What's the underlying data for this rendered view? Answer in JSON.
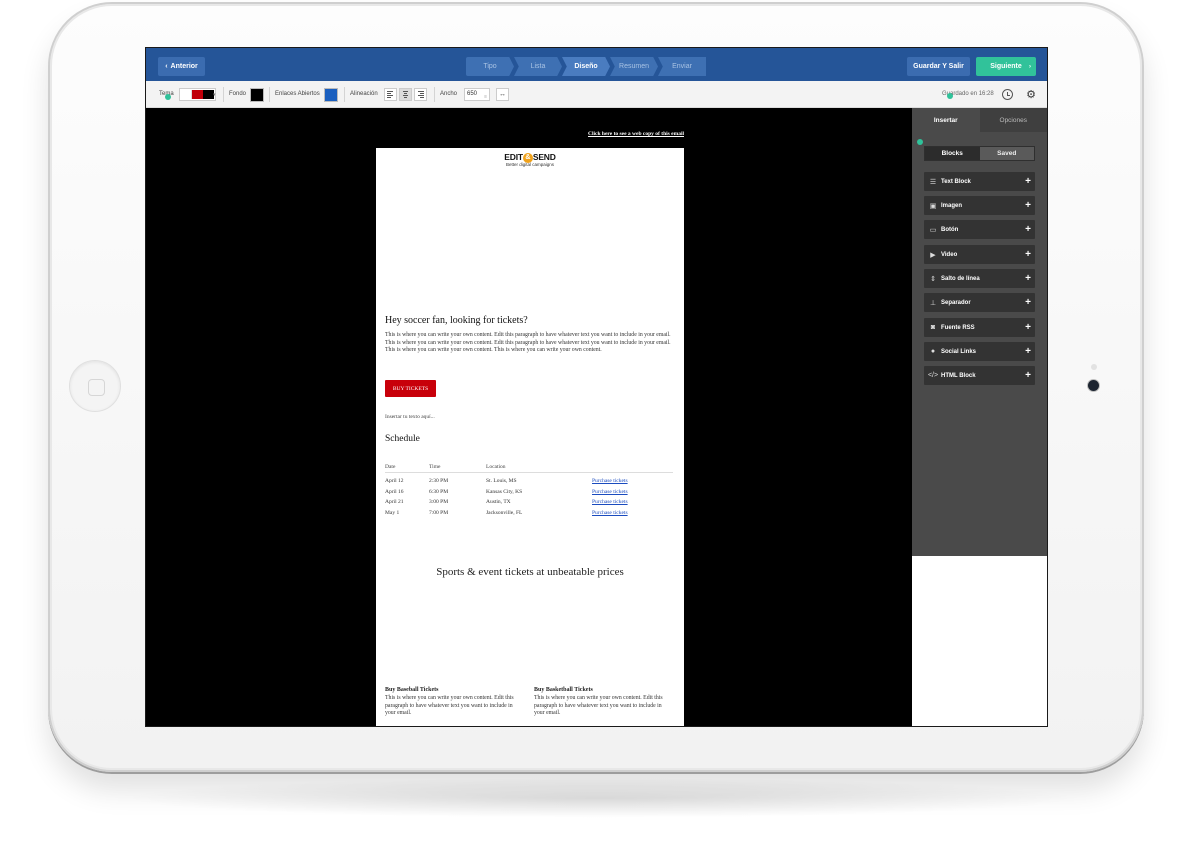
{
  "nav": {
    "prev_label": "Anterior",
    "steps": [
      "Tipo",
      "Lista",
      "Diseño",
      "Resumen",
      "Enviar"
    ],
    "active_step": "Diseño",
    "save_exit_label": "Guardar Y Salir",
    "next_label": "Siguiente"
  },
  "toolbar": {
    "theme_label": "Tema",
    "background_label": "Fondo",
    "links_label": "Enlaces Abiertos",
    "align_label": "Alineación",
    "width_label": "Ancho",
    "width_value": "650",
    "saved_text": "Guardado en 16:28",
    "colors": {
      "theme_a": "#c0000a",
      "theme_b": "#000000",
      "background": "#000000",
      "links": "#1a5fbf"
    }
  },
  "email": {
    "web_copy_link": "Click here to see a web copy of this email",
    "logo_left": "EDIT",
    "logo_amp": "&",
    "logo_right": "SEND",
    "logo_tagline": "Better digital campaigns",
    "heading": "Hey soccer fan, looking for tickets?",
    "paragraph": "This is where you can write your own content. Edit this paragraph to have whatever text you want to include in your email. This is where you can write your own content. Edit this paragraph to have whatever text you want to include in your email. This is where you can write your own content. This is where you can write your own content.",
    "buy_button": "BUY TICKETS",
    "insert_text": "Insertar tu texto aquí...",
    "schedule_title": "Schedule",
    "table": {
      "headers": [
        "Date",
        "Time",
        "Location",
        ""
      ],
      "rows": [
        [
          "April 12",
          "2:30 PM",
          "St. Louis, MS",
          "Purchase tickets"
        ],
        [
          "April 16",
          "6:30 PM",
          "Kansas City, KS",
          "Purchase tickets"
        ],
        [
          "April 21",
          "3:00 PM",
          "Austin, TX",
          "Purchase tickets"
        ],
        [
          "May 1",
          "7:00 PM",
          "Jacksonville, FL",
          "Purchase tickets"
        ]
      ]
    },
    "tagline": "Sports & event tickets at unbeatable prices",
    "col_left_title": "Buy Baseball Tickets",
    "col_left_text": "This is where you can write your own content. Edit this paragraph to have whatever text you want to include in your email.",
    "col_right_title": "Buy Basketball Tickets",
    "col_right_text": "This is where you can write your own content. Edit this paragraph to have whatever text you want to include in your email."
  },
  "panel": {
    "tabs": [
      "Insertar",
      "Opciones"
    ],
    "segments": [
      "Blocks",
      "Saved"
    ],
    "blocks": [
      {
        "label": "Text Block",
        "icon": "text-icon"
      },
      {
        "label": "Imagen",
        "icon": "image-icon"
      },
      {
        "label": "Botón",
        "icon": "button-icon"
      },
      {
        "label": "Video",
        "icon": "video-icon"
      },
      {
        "label": "Salto de línea",
        "icon": "line-break-icon"
      },
      {
        "label": "Separador",
        "icon": "separator-icon"
      },
      {
        "label": "Fuente RSS",
        "icon": "rss-icon"
      },
      {
        "label": "Social Links",
        "icon": "social-icon"
      },
      {
        "label": "HTML Block",
        "icon": "code-icon"
      }
    ]
  }
}
